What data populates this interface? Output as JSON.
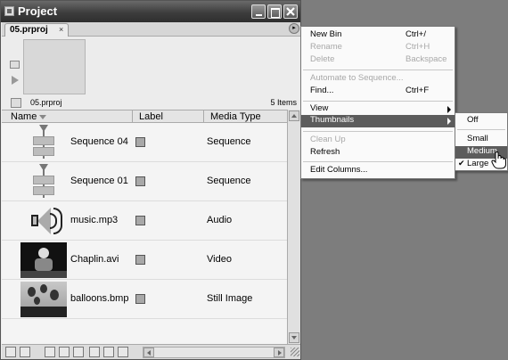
{
  "window": {
    "title": "Project",
    "tab_label": "05.prproj",
    "tab_close": "×",
    "panel_menu": "▸"
  },
  "info": {
    "project_name": "05.prproj",
    "item_count": "5 Items"
  },
  "columns": {
    "name": "Name",
    "label": "Label",
    "media_type": "Media Type"
  },
  "rows": [
    {
      "name": "Sequence 04",
      "type": "Sequence",
      "thumb": "sequence-icon",
      "label_color": "#a8a8a8"
    },
    {
      "name": "Sequence 01",
      "type": "Sequence",
      "thumb": "sequence-icon",
      "label_color": "#a8a8a8"
    },
    {
      "name": "music.mp3",
      "type": "Audio",
      "thumb": "speaker-icon",
      "label_color": "#a8a8a8"
    },
    {
      "name": "Chaplin.avi",
      "type": "Video",
      "thumb": "video-thumbnail",
      "label_color": "#a8a8a8"
    },
    {
      "name": "balloons.bmp",
      "type": "Still Image",
      "thumb": "image-thumbnail",
      "label_color": "#a8a8a8"
    }
  ],
  "context_menu": {
    "items": [
      {
        "label": "New Bin",
        "shortcut": "Ctrl+/",
        "enabled": true
      },
      {
        "label": "Rename",
        "shortcut": "Ctrl+H",
        "enabled": false
      },
      {
        "label": "Delete",
        "shortcut": "Backspace",
        "enabled": false
      },
      {
        "label": "Automate to Sequence...",
        "shortcut": "",
        "enabled": false
      },
      {
        "label": "Find...",
        "shortcut": "Ctrl+F",
        "enabled": true
      },
      {
        "label": "View",
        "shortcut": "",
        "enabled": true,
        "submenu": true
      },
      {
        "label": "Thumbnails",
        "shortcut": "",
        "enabled": true,
        "submenu": true,
        "highlighted": true
      },
      {
        "label": "Clean Up",
        "shortcut": "",
        "enabled": false
      },
      {
        "label": "Refresh",
        "shortcut": "",
        "enabled": true
      },
      {
        "label": "Edit Columns...",
        "shortcut": "",
        "enabled": true
      }
    ]
  },
  "thumbnails_submenu": {
    "items": [
      {
        "label": "Off",
        "checked": false,
        "highlighted": false
      },
      {
        "label": "Small",
        "checked": false,
        "highlighted": false
      },
      {
        "label": "Medium",
        "checked": false,
        "highlighted": true
      },
      {
        "label": "Large",
        "checked": true,
        "highlighted": false
      }
    ],
    "checkmark": "✔"
  },
  "colors": {
    "highlight": "#5c5c5c",
    "desktop": "#7d7d7d",
    "titlebar": "#3d3d3d"
  }
}
